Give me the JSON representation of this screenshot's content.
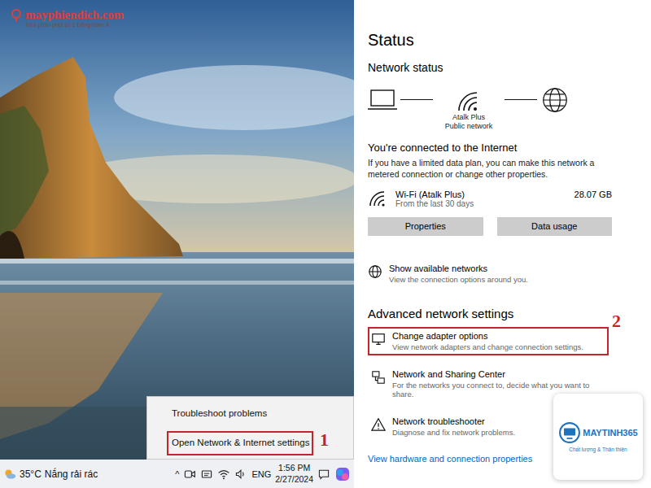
{
  "watermark": {
    "name": "mayphiendich.com",
    "tagline": "Nhà phân phối số 1 Đông Nam Á"
  },
  "context_menu": {
    "items": [
      {
        "label": "Troubleshoot problems",
        "highlighted": false
      },
      {
        "label": "Open Network & Internet settings",
        "highlighted": true,
        "marker": "1"
      }
    ]
  },
  "taskbar": {
    "temperature": "35°C",
    "weather": "Nắng rải rác",
    "overflow": "^",
    "language": "ENG",
    "time": "1:56 PM",
    "date": "2/27/2024"
  },
  "settings": {
    "title": "Status",
    "section": "Network status",
    "network": {
      "name": "Atalk Plus",
      "type": "Public network"
    },
    "connection": {
      "heading": "You're connected to the Internet",
      "description": "If you have a limited data plan, you can make this network a metered connection or change other properties."
    },
    "adapter": {
      "name": "Wi-Fi (Atalk Plus)",
      "period": "From the last 30 days",
      "usage": "28.07 GB",
      "buttons": [
        "Properties",
        "Data usage"
      ]
    },
    "show_networks": {
      "title": "Show available networks",
      "description": "View the connection options around you."
    },
    "advanced": {
      "heading": "Advanced network settings",
      "items": [
        {
          "title": "Change adapter options",
          "description": "View network adapters and change connection settings.",
          "highlighted": true,
          "marker": "2"
        },
        {
          "title": "Network and Sharing Center",
          "description": "For the networks you connect to, decide what you want to share.",
          "highlighted": false
        },
        {
          "title": "Network troubleshooter",
          "description": "Diagnose and fix network problems.",
          "highlighted": false
        }
      ]
    },
    "link": "View hardware and connection properties"
  },
  "logo": {
    "name": "MAYTINH365",
    "tagline": "Chất lượng & Thân thiện"
  }
}
